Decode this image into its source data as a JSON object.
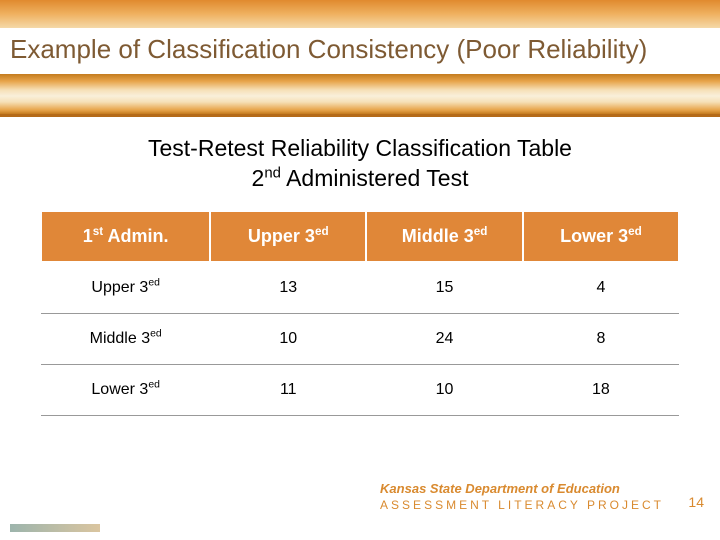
{
  "title": "Example of Classification Consistency (Poor Reliability)",
  "subtitle": {
    "line1_pre": "Test-Retest Reliability Classification Table",
    "line2_pre": "2",
    "line2_sup": "nd",
    "line2_post": " Administered Test"
  },
  "table": {
    "headers": {
      "h0_pre": "1",
      "h0_sup": "st",
      "h0_post": " Admin.",
      "h1_pre": "Upper 3",
      "h1_sup": "ed",
      "h2_pre": "Middle 3",
      "h2_sup": "ed",
      "h3_pre": "Lower 3",
      "h3_sup": "ed"
    },
    "rows": [
      {
        "label_pre": "Upper 3",
        "label_sup": "ed",
        "c1": "13",
        "c2": "15",
        "c3": "4"
      },
      {
        "label_pre": "Middle 3",
        "label_sup": "ed",
        "c1": "10",
        "c2": "24",
        "c3": "8"
      },
      {
        "label_pre": "Lower 3",
        "label_sup": "ed",
        "c1": "11",
        "c2": "10",
        "c3": "18"
      }
    ]
  },
  "footer": {
    "org": "Kansas State Department of Education",
    "project": "ASSESSMENT LITERACY PROJECT"
  },
  "page_number": "14",
  "chart_data": {
    "type": "table",
    "title": "Test-Retest Reliability Classification Table — 2nd Administered Test",
    "row_label": "1st Admin.",
    "columns": [
      "Upper 3ed",
      "Middle 3ed",
      "Lower 3ed"
    ],
    "rows": [
      "Upper 3ed",
      "Middle 3ed",
      "Lower 3ed"
    ],
    "values": [
      [
        13,
        15,
        4
      ],
      [
        10,
        24,
        8
      ],
      [
        11,
        10,
        18
      ]
    ]
  }
}
